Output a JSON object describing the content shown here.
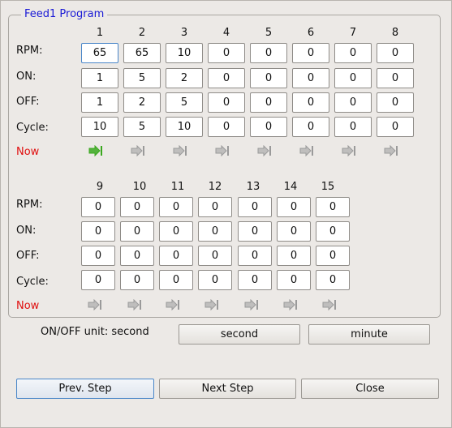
{
  "group_title": "Feed1 Program",
  "rows": [
    "RPM:",
    "ON:",
    "OFF:",
    "Cycle:"
  ],
  "now_label": "Now",
  "block1": {
    "cols": [
      "1",
      "2",
      "3",
      "4",
      "5",
      "6",
      "7",
      "8"
    ],
    "values": [
      [
        "65",
        "65",
        "10",
        "0",
        "0",
        "0",
        "0",
        "0"
      ],
      [
        "1",
        "5",
        "2",
        "0",
        "0",
        "0",
        "0",
        "0"
      ],
      [
        "1",
        "2",
        "5",
        "0",
        "0",
        "0",
        "0",
        "0"
      ],
      [
        "10",
        "5",
        "10",
        "0",
        "0",
        "0",
        "0",
        "0"
      ]
    ],
    "now_active_index": 0
  },
  "block2": {
    "cols": [
      "9",
      "10",
      "11",
      "12",
      "13",
      "14",
      "15"
    ],
    "values": [
      [
        "0",
        "0",
        "0",
        "0",
        "0",
        "0",
        "0"
      ],
      [
        "0",
        "0",
        "0",
        "0",
        "0",
        "0",
        "0"
      ],
      [
        "0",
        "0",
        "0",
        "0",
        "0",
        "0",
        "0"
      ],
      [
        "0",
        "0",
        "0",
        "0",
        "0",
        "0",
        "0"
      ]
    ],
    "now_active_index": -1
  },
  "unit_text": "ON/OFF unit: second",
  "buttons": {
    "second": "second",
    "minute": "minute",
    "prev": "Prev. Step",
    "next": "Next Step",
    "close": "Close"
  },
  "colors": {
    "title": "#1a1ad6",
    "now_label": "#e01010",
    "arrow_active": "#3aa81e",
    "arrow_inactive": "#9a9a9a",
    "focus": "#4a86c8"
  },
  "icons": {
    "step_indicator": "arrow-into-bar-icon"
  }
}
